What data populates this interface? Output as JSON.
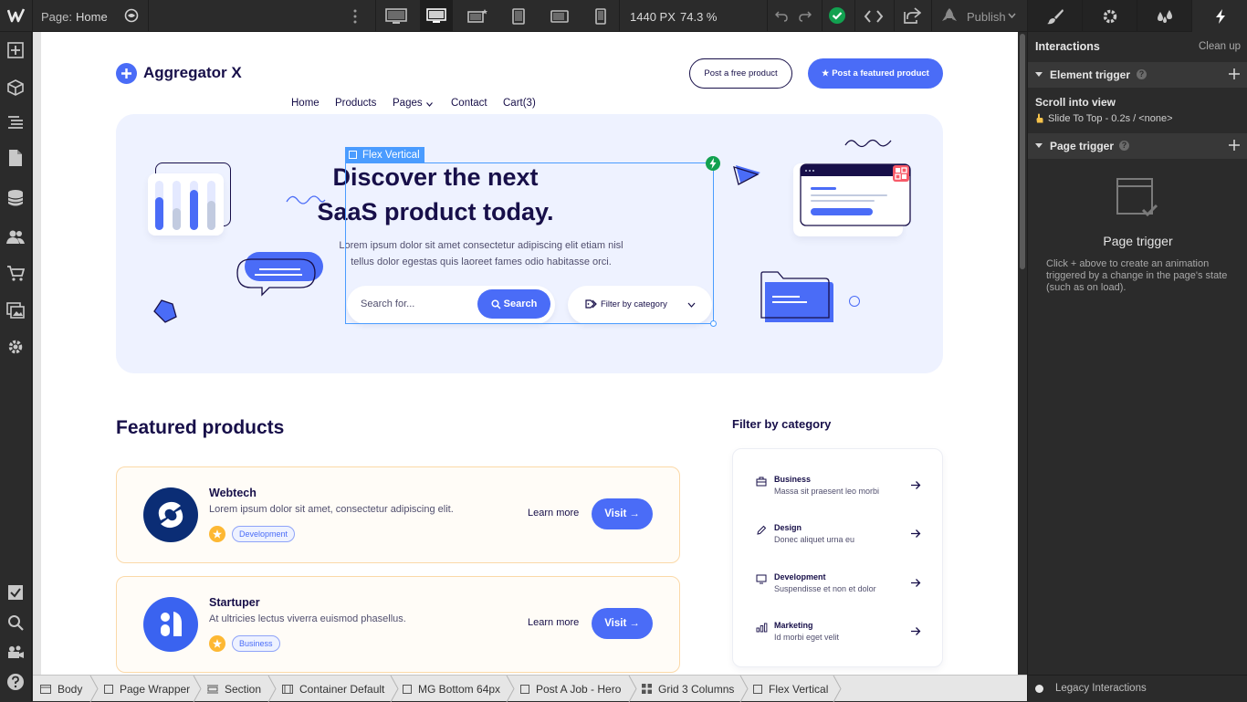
{
  "topbar": {
    "page_label": "Page:",
    "page_name": "Home",
    "width_value": "1440 PX",
    "zoom_value": "74.3 %",
    "publish_label": "Publish"
  },
  "canvas": {
    "brand": "Aggregator X",
    "nav": {
      "home": "Home",
      "products": "Products",
      "pages": "Pages",
      "contact": "Contact",
      "cart": "Cart(3)"
    },
    "post_free_label": "Post a free product",
    "post_featured_label": "Post a featured product",
    "selection_label": "Flex Vertical",
    "hero_title_line1": "Discover the next",
    "hero_title_line2": "SaaS product today.",
    "hero_desc_line1": "Lorem ipsum dolor sit amet consectetur adipiscing elit etiam nisl",
    "hero_desc_line2": "tellus dolor egestas quis laoreet fames odio habitasse orci.",
    "search_placeholder": "Search for...",
    "search_button": "Search",
    "filter_label": "Filter by category",
    "featured_title": "Featured products",
    "filter_title": "Filter by category",
    "products": [
      {
        "name": "Webtech",
        "desc": "Lorem ipsum dolor sit amet, consectetur adipiscing elit.",
        "tag": "Development",
        "learn": "Learn more",
        "visit": "Visit"
      },
      {
        "name": "Startuper",
        "desc": "At ultricies lectus viverra euismod phasellus.",
        "tag": "Business",
        "learn": "Learn more",
        "visit": "Visit"
      }
    ],
    "categories": [
      {
        "name": "Business",
        "desc": "Massa sit praesent leo morbi"
      },
      {
        "name": "Design",
        "desc": "Donec aliquet urna eu"
      },
      {
        "name": "Development",
        "desc": "Suspendisse et non et dolor"
      },
      {
        "name": "Marketing",
        "desc": "Id morbi eget velit"
      }
    ]
  },
  "right_panel": {
    "title": "Interactions",
    "clean_up": "Clean up",
    "element_trigger": "Element trigger",
    "scroll_into_view": "Scroll into view",
    "scroll_detail": "Slide To Top - 0.2s / <none>",
    "page_trigger": "Page trigger",
    "page_trigger_heading": "Page trigger",
    "page_trigger_desc": "Click + above to create an animation triggered by a change in the page's state (such as on load).",
    "legacy": "Legacy Interactions"
  },
  "breadcrumb": [
    "Body",
    "Page Wrapper",
    "Section",
    "Container Default",
    "MG Bottom 64px",
    "Post A Job - Hero",
    "Grid 3 Columns",
    "Flex Vertical"
  ],
  "colors": {
    "accent": "#4a6cf7",
    "dark": "#170f49",
    "hero_bg": "#eef2ff",
    "editor_bg": "#2b2b2b",
    "success": "#12a150"
  }
}
